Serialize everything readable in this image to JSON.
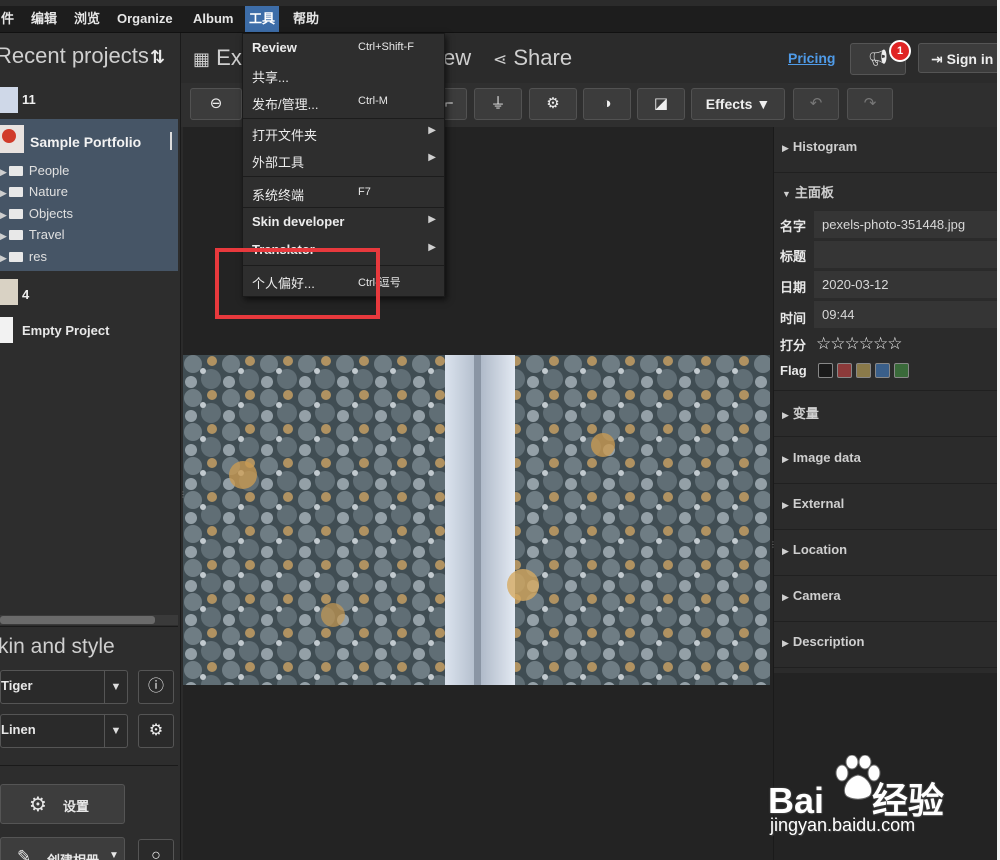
{
  "menubar": {
    "items": [
      {
        "label": "件",
        "active": false
      },
      {
        "label": "编辑",
        "active": false
      },
      {
        "label": "浏览",
        "active": false
      },
      {
        "label": "Organize",
        "active": false
      },
      {
        "label": "Album",
        "active": false
      },
      {
        "label": "工具",
        "active": true
      },
      {
        "label": "帮助",
        "active": false
      }
    ]
  },
  "left": {
    "recent_title": "Recent projects",
    "projects": [
      {
        "count": "11"
      },
      {
        "name": "Sample Portfolio"
      },
      {
        "count": "4"
      },
      {
        "name": "Empty Project"
      }
    ],
    "tree": [
      "People",
      "Nature",
      "Objects",
      "Travel",
      "res"
    ],
    "skin_title": "kin and style",
    "skin_select": "Tiger",
    "style_select": "Linen",
    "settings_label": "设置",
    "create_album_label": "创建相册"
  },
  "header": {
    "explore_label": "Ex",
    "view_label": "ew",
    "share_label": "Share",
    "pricing": "Pricing",
    "notification_count": "1",
    "signin": "Sign in"
  },
  "toolbar": {
    "effects_label": "Effects"
  },
  "tools_menu": {
    "items": [
      {
        "label": "Review",
        "shortcut": "Ctrl+Shift-F",
        "bold": true,
        "submenu": false
      },
      {
        "label": "共享...",
        "shortcut": "",
        "bold": false,
        "submenu": false
      },
      {
        "label": "发布/管理...",
        "shortcut": "Ctrl-M",
        "bold": false,
        "submenu": false
      },
      {
        "label": "打开文件夹",
        "shortcut": "",
        "bold": false,
        "submenu": true
      },
      {
        "label": "外部工具",
        "shortcut": "",
        "bold": false,
        "submenu": true
      },
      {
        "label": "系统终端",
        "shortcut": "F7",
        "bold": false,
        "submenu": false
      },
      {
        "label": "Skin developer",
        "shortcut": "",
        "bold": true,
        "submenu": true
      },
      {
        "label": "Translator",
        "shortcut": "",
        "bold": true,
        "submenu": true
      },
      {
        "label": "个人偏好...",
        "shortcut": "Ctrl-逗号",
        "bold": false,
        "submenu": false
      }
    ]
  },
  "right": {
    "histogram": "Histogram",
    "main_panel": "主面板",
    "props": [
      {
        "label": "名字",
        "value": "pexels-photo-351448.jpg"
      },
      {
        "label": "标题",
        "value": ""
      },
      {
        "label": "日期",
        "value": "2020-03-12"
      },
      {
        "label": "时间",
        "value": "09:44"
      }
    ],
    "rating_label": "打分",
    "stars": "☆☆☆☆☆☆",
    "flag_label": "Flag",
    "flag_colors": [
      "#1a1a1a",
      "#8c3a3a",
      "#8a7a4a",
      "#3a5f8a",
      "#3a6a3a"
    ],
    "sections": [
      "变量",
      "Image data",
      "External",
      "Location",
      "Camera",
      "Description"
    ]
  },
  "watermark": {
    "brand": "Bai",
    "brand_cn": "经验",
    "url": "jingyan.baidu.com"
  }
}
